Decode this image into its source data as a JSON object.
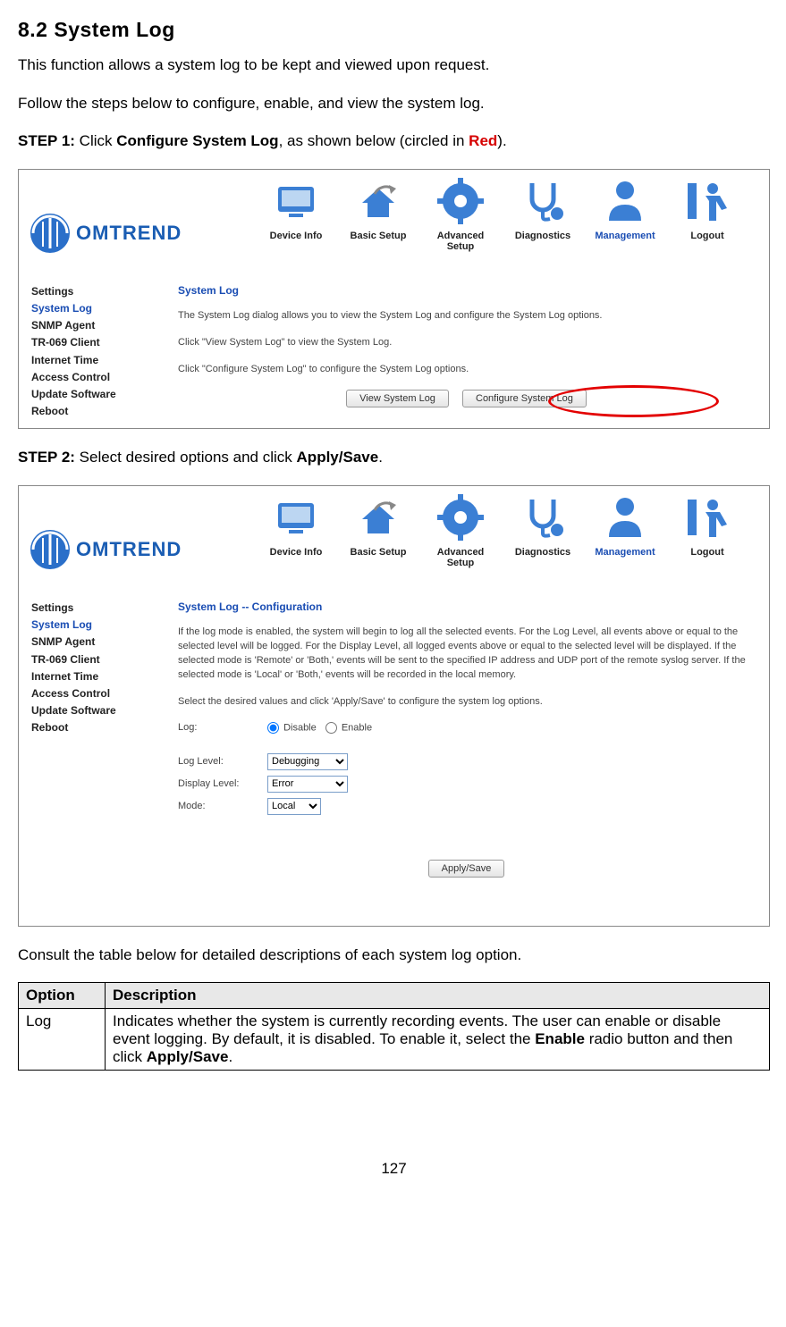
{
  "section": {
    "number": "8.2",
    "title": "System Log"
  },
  "intro": {
    "p1": "This function allows a system log to be kept and viewed upon request.",
    "p2": "Follow the steps below to configure, enable, and view the system log."
  },
  "step1": {
    "label": "STEP 1:",
    "before": "  Click ",
    "bold": "Configure System Log",
    "mid": ", as shown below (circled in ",
    "red": "Red",
    "after": ")."
  },
  "step2": {
    "label": "STEP 2:",
    "before": "  Select desired options and click ",
    "bold": "Apply/Save",
    "after": "."
  },
  "logo_text": "OMTREND",
  "nav": {
    "items": [
      {
        "label": "Device Info"
      },
      {
        "label": "Basic Setup"
      },
      {
        "label": "Advanced Setup"
      },
      {
        "label": "Diagnostics"
      },
      {
        "label": "Management"
      },
      {
        "label": "Logout"
      }
    ]
  },
  "sidebar": {
    "items": [
      {
        "label": "Settings"
      },
      {
        "label": "System Log"
      },
      {
        "label": "SNMP Agent"
      },
      {
        "label": "TR-069 Client"
      },
      {
        "label": "Internet Time"
      },
      {
        "label": "Access Control"
      },
      {
        "label": "Update Software"
      },
      {
        "label": "Reboot"
      }
    ]
  },
  "panel1": {
    "title": "System Log",
    "p1": "The System Log dialog allows you to view the System Log and configure the System Log options.",
    "p2": "Click \"View System Log\" to view the System Log.",
    "p3": "Click \"Configure System Log\" to configure the System Log options.",
    "btn_view": "View System Log",
    "btn_conf": "Configure System Log"
  },
  "panel2": {
    "title": "System Log -- Configuration",
    "p1": "If the log mode is enabled, the system will begin to log all the selected events. For the Log Level, all events above or equal to the selected level will be logged. For the Display Level, all logged events above or equal to the selected level will be displayed. If the selected mode is 'Remote' or 'Both,' events will be sent to the specified IP address and UDP port of the remote syslog server. If the selected mode is 'Local' or 'Both,' events will be recorded in the local memory.",
    "p2": "Select the desired values and click 'Apply/Save' to configure the system log options.",
    "log_label": "Log:",
    "disable": "Disable",
    "enable": "Enable",
    "loglevel_label": "Log Level:",
    "loglevel_value": "Debugging",
    "display_label": "Display Level:",
    "display_value": "Error",
    "mode_label": "Mode:",
    "mode_value": "Local",
    "btn_apply": "Apply/Save"
  },
  "table_intro": "Consult the table below for detailed descriptions of each system log option.",
  "table": {
    "h1": "Option",
    "h2": "Description",
    "r1c1": "Log",
    "r1c2_a": "Indicates whether the system is currently recording events.   The user can enable or disable event logging.   By default, it is disabled.   To enable it, select the ",
    "r1c2_b": "Enable",
    "r1c2_c": " radio button and then click ",
    "r1c2_d": "Apply/Save",
    "r1c2_e": "."
  },
  "page_number": "127"
}
